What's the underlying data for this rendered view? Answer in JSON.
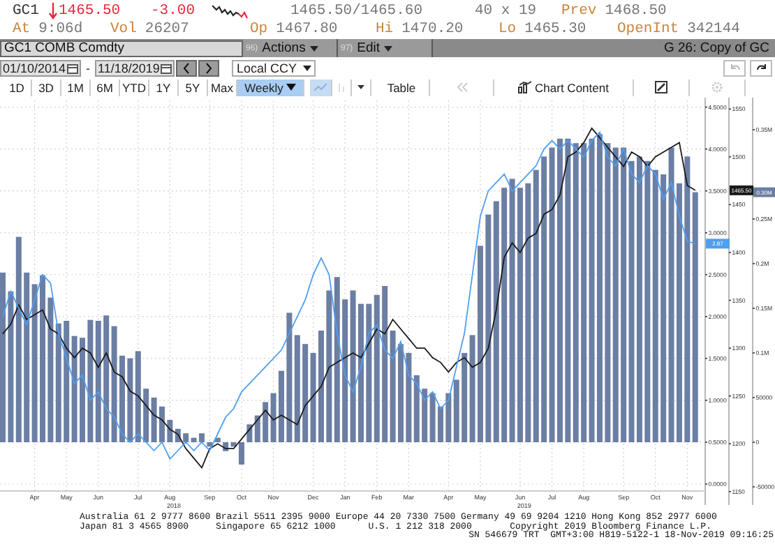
{
  "quote": {
    "symbol": "GC1",
    "price_down": true,
    "last": "1465.50",
    "change": "-3.00",
    "bid_ask": "1465.50/1465.60",
    "size": "40 x 19",
    "prev_label": "Prev",
    "prev": "1468.50",
    "stats": [
      {
        "label": "At",
        "value": "9:06d"
      },
      {
        "label": "Vol",
        "value": "26207"
      },
      {
        "label": "Op",
        "value": "1467.80"
      },
      {
        "label": "Hi",
        "value": "1470.20"
      },
      {
        "label": "Lo",
        "value": "1465.30"
      },
      {
        "label": "OpenInt",
        "value": "342144"
      }
    ]
  },
  "toolbar": {
    "security": "GC1 COMB Comdty",
    "menus": [
      {
        "number": "96)",
        "label": "Actions"
      },
      {
        "number": "97)",
        "label": "Edit"
      }
    ],
    "page_title": "G 26: Copy of GC"
  },
  "range": {
    "start": "01/10/2014",
    "separator": "-",
    "end": "11/18/2019",
    "currency": "Local CCY"
  },
  "periods": [
    {
      "label": "1D",
      "selected": false
    },
    {
      "label": "3D",
      "selected": false
    },
    {
      "label": "1M",
      "selected": false
    },
    {
      "label": "6M",
      "selected": false
    },
    {
      "label": "YTD",
      "selected": false
    },
    {
      "label": "1Y",
      "selected": false
    },
    {
      "label": "5Y",
      "selected": false
    },
    {
      "label": "Max",
      "selected": false
    }
  ],
  "frequency": "Weekly",
  "table_button": "Table",
  "chart_content_button": "Chart Content",
  "chart": {
    "chart_data": {
      "type": "line",
      "grid": true,
      "categories": [
        null,
        null,
        null,
        null,
        "Apr",
        null,
        null,
        null,
        "May",
        null,
        null,
        null,
        "Jun",
        null,
        null,
        null,
        null,
        "Jul",
        null,
        null,
        null,
        "Aug",
        null,
        null,
        null,
        null,
        "Sep",
        null,
        null,
        null,
        "Oct",
        null,
        null,
        null,
        "Nov",
        null,
        null,
        null,
        null,
        "Dec",
        null,
        null,
        null,
        "Jan",
        null,
        null,
        null,
        "Feb",
        null,
        null,
        null,
        "Mar",
        null,
        null,
        null,
        null,
        "Apr",
        null,
        null,
        null,
        "May",
        null,
        null,
        null,
        null,
        "Jun",
        null,
        null,
        null,
        "Jul",
        null,
        null,
        null,
        "Aug",
        null,
        null,
        null,
        null,
        "Sep",
        null,
        null,
        null,
        "Oct",
        null,
        null,
        null,
        "Nov",
        null
      ],
      "annotations": [
        "2018",
        "2019"
      ],
      "y3lim": [
        -70300,
        382800
      ],
      "y3ticks": [
        {
          "value": 350000,
          "label": "0.35M"
        },
        {
          "value": 250000,
          "label": "0.25M"
        },
        {
          "value": 200000,
          "label": "0.2M"
        },
        {
          "value": 150000,
          "label": "0.15M"
        },
        {
          "value": 100000,
          "label": "0.1M"
        },
        {
          "value": 50000,
          "label": "50000"
        },
        {
          "value": 0,
          "label": "0"
        },
        {
          "value": -50000,
          "label": "-50000"
        }
      ],
      "y2lim": [
        1136,
        1559
      ],
      "y2ticks": [
        {
          "value": 1550,
          "label": "1550"
        },
        {
          "value": 1500,
          "label": "1500"
        },
        {
          "value": 1450,
          "label": "1450"
        },
        {
          "value": 1400,
          "label": "1400"
        },
        {
          "value": 1350,
          "label": "1350"
        },
        {
          "value": 1300,
          "label": "1300"
        },
        {
          "value": 1250,
          "label": "1250"
        },
        {
          "value": 1200,
          "label": "1200"
        },
        {
          "value": 1150,
          "label": "1150"
        }
      ],
      "ylim": [
        -0.25,
        4.58
      ],
      "yticks": [
        {
          "value": 4.5,
          "label": "4.5000"
        },
        {
          "value": 4,
          "label": "4.0000"
        },
        {
          "value": 3.5,
          "label": "3.5000"
        },
        {
          "value": 3,
          "label": "3.0000"
        },
        {
          "value": 2.5,
          "label": "2.5000"
        },
        {
          "value": 2,
          "label": "2.0000"
        },
        {
          "value": 1.5,
          "label": "1.5000"
        },
        {
          "value": 1,
          "label": "1.0000"
        },
        {
          "value": 0.5,
          "label": "0.5000"
        },
        {
          "value": 0,
          "label": "0.0000"
        }
      ],
      "series": [
        {
          "type": "bar",
          "axis": "y3",
          "color": "#6b7ea3",
          "values": [
            190000,
            169000,
            230000,
            190000,
            177000,
            187000,
            162000,
            133000,
            136000,
            119000,
            117000,
            137000,
            136000,
            142000,
            130000,
            97000,
            94000,
            102000,
            60000,
            50000,
            40000,
            25000,
            15000,
            10000,
            5000,
            10000,
            -5000,
            5000,
            -10000,
            -5000,
            -25000,
            20000,
            30000,
            45000,
            55000,
            80000,
            145000,
            120000,
            110000,
            100000,
            125000,
            170000,
            185000,
            160000,
            170000,
            155000,
            155000,
            165000,
            175000,
            125000,
            110000,
            100000,
            75000,
            60000,
            55000,
            40000,
            55000,
            70000,
            100000,
            120000,
            220000,
            255000,
            270000,
            285000,
            295000,
            285000,
            290000,
            305000,
            320000,
            330000,
            340000,
            340000,
            335000,
            335000,
            340000,
            345000,
            335000,
            330000,
            330000,
            315000,
            320000,
            315000,
            305000,
            300000,
            330000,
            290000,
            320000,
            280000
          ]
        },
        {
          "axis": "y2",
          "color": "#1a1a1a",
          "values": [
            1315,
            1325,
            1345,
            1330,
            1335,
            1340,
            1320,
            1315,
            1300,
            1290,
            1300,
            1295,
            1280,
            1295,
            1275,
            1270,
            1255,
            1250,
            1240,
            1230,
            1225,
            1215,
            1210,
            1195,
            1185,
            1175,
            1195,
            1200,
            1195,
            1195,
            1205,
            1215,
            1225,
            1235,
            1225,
            1230,
            1225,
            1220,
            1240,
            1250,
            1260,
            1280,
            1285,
            1290,
            1295,
            1290,
            1305,
            1320,
            1315,
            1330,
            1320,
            1310,
            1300,
            1300,
            1290,
            1285,
            1275,
            1285,
            1290,
            1280,
            1285,
            1300,
            1340,
            1395,
            1410,
            1400,
            1415,
            1420,
            1440,
            1445,
            1460,
            1500,
            1505,
            1515,
            1530,
            1520,
            1510,
            1500,
            1490,
            1505,
            1500,
            1490,
            1500,
            1505,
            1510,
            1515,
            1470,
            1465
          ]
        },
        {
          "color": "#4f9ff0",
          "values": [
            2.0,
            2.3,
            2.1,
            1.9,
            2.2,
            2.5,
            2.4,
            1.8,
            1.5,
            1.2,
            1.3,
            1.0,
            1.1,
            0.9,
            0.8,
            0.6,
            0.5,
            0.6,
            0.5,
            0.4,
            0.5,
            0.3,
            0.4,
            0.5,
            0.4,
            0.5,
            0.4,
            0.6,
            0.8,
            0.9,
            1.1,
            1.2,
            1.3,
            1.4,
            1.5,
            1.6,
            1.8,
            2.0,
            2.2,
            2.5,
            2.7,
            2.5,
            1.8,
            1.3,
            1.1,
            1.4,
            1.8,
            1.9,
            1.6,
            1.5,
            1.7,
            1.3,
            1.2,
            1.0,
            1.1,
            0.9,
            1.0,
            1.4,
            1.8,
            2.5,
            3.2,
            3.5,
            3.6,
            3.7,
            3.5,
            3.6,
            3.7,
            3.8,
            4.0,
            4.1,
            4.0,
            4.1,
            4.0,
            3.9,
            4.1,
            4.2,
            3.9,
            3.8,
            4.0,
            3.7,
            3.6,
            3.8,
            3.7,
            3.4,
            3.6,
            3.2,
            2.9,
            2.87
          ]
        }
      ]
    },
    "value_tags": [
      "2.87",
      "1465.50",
      "0.30M"
    ]
  },
  "footer": {
    "lines": [
      "Australia 61 2 9777 8600 Brazil 5511 2395 9000 Europe 44 20 7330 7500 Germany 49 69 9204 1210 Hong Kong 852 2977 6000",
      "Japan 81 3 4565 8900     Singapore 65 6212 1000      U.S. 1 212 318 2000       Copyright 2019 Bloomberg Finance L.P."
    ],
    "stamp": "SN 546679 TRT  GMT+3:00 H819-5122-1 18-Nov-2019 09:16:25"
  }
}
